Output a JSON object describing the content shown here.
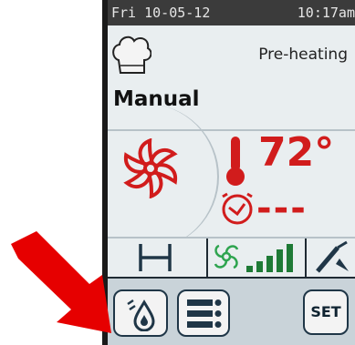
{
  "status_bar": {
    "date": "Fri 10-05-12",
    "time": "10:17am"
  },
  "header": {
    "mode_label": "Manual",
    "status_text": "Pre-heating"
  },
  "readouts": {
    "temperature": "72°",
    "timer": "---"
  },
  "bottom_bar": {
    "set_label": "SET"
  },
  "colors": {
    "accent_red": "#d11c1c",
    "navy": "#1f3647",
    "annotation_arrow": "#e60000"
  },
  "icons": [
    "chef-hat-icon",
    "fan-icon",
    "thermometer-icon",
    "clock-icon",
    "humidity-h-icon",
    "fan-speed-icon",
    "probe-icon",
    "steam-drop-icon",
    "menu-list-icon"
  ]
}
